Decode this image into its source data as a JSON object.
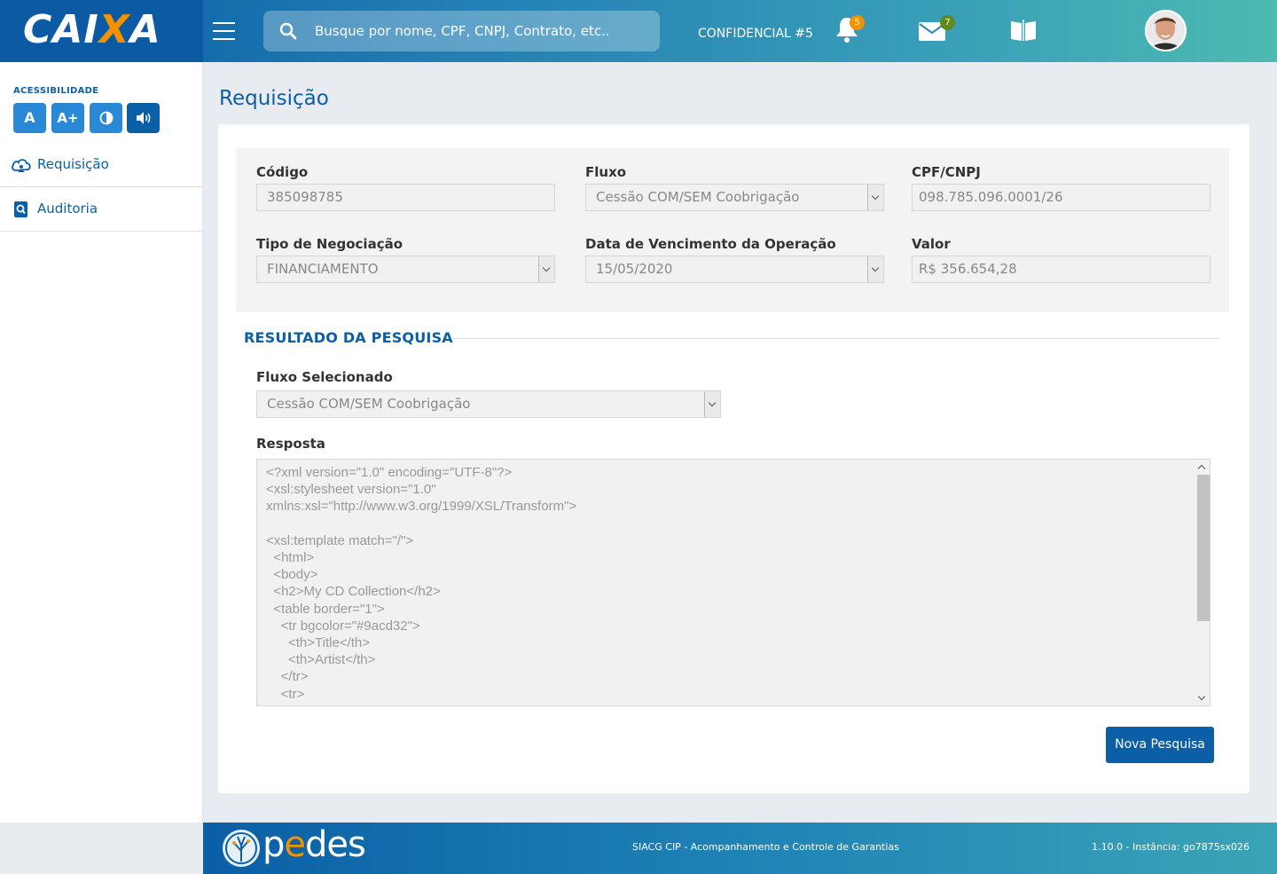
{
  "header": {
    "logo_prefix": "CAI",
    "logo_x": "X",
    "logo_suffix": "A",
    "search_placeholder": "Busque por nome, CPF, CNPJ, Contrato, etc..",
    "confidential_label": "CONFIDENCIAL #5",
    "notifications_count": "5",
    "messages_count": "7",
    "colors": {
      "brand_blue": "#0a5fa6",
      "brand_orange": "#f39200",
      "badge_green": "#5f8a1d"
    }
  },
  "sidebar": {
    "accessibility_title": "ACESSIBILIDADE",
    "acc_buttons": [
      "A",
      "A+",
      "◐",
      "🔊"
    ],
    "items": [
      {
        "label": "Requisição",
        "icon": "cloud-user-icon"
      },
      {
        "label": "Auditoria",
        "icon": "search-doc-icon"
      }
    ]
  },
  "main": {
    "page_title": "Requisição",
    "filters": {
      "codigo": {
        "label": "Código",
        "value": "385098785"
      },
      "fluxo": {
        "label": "Fluxo",
        "value": "Cessão COM/SEM Coobrigação"
      },
      "cpf_cnpj": {
        "label": "CPF/CNPJ",
        "value": "098.785.096.0001/26"
      },
      "tipo_negociacao": {
        "label": "Tipo de Negociação",
        "value": "FINANCIAMENTO"
      },
      "data_vencimento": {
        "label": "Data de Vencimento da Operação",
        "value": "15/05/2020"
      },
      "valor": {
        "label": "Valor",
        "value": "R$ 356.654,28"
      }
    },
    "result": {
      "title": "RESULTADO DA PESQUISA",
      "fluxo_selecionado": {
        "label": "Fluxo Selecionado",
        "value": "Cessão COM/SEM Coobrigação"
      },
      "resposta": {
        "label": "Resposta",
        "content": "<?xml version=\"1.0\" encoding=\"UTF-8\"?>\n<xsl:stylesheet version=\"1.0\"\nxmlns:xsl=\"http://www.w3.org/1999/XSL/Transform\">\n\n<xsl:template match=\"/\">\n  <html>\n  <body>\n  <h2>My CD Collection</h2>\n  <table border=\"1\">\n    <tr bgcolor=\"#9acd32\">\n      <th>Title</th>\n      <th>Artist</th>\n    </tr>\n    <tr>"
      },
      "new_search_label": "Nova Pesquisa"
    }
  },
  "footer": {
    "brand_prefix": "p",
    "brand_e": "e",
    "brand_suffix": "des",
    "system_name": "SIACG CIP - Acompanhamento e Controle de Garantias",
    "version": "1.10.0 - Instância: go7875sx026"
  }
}
